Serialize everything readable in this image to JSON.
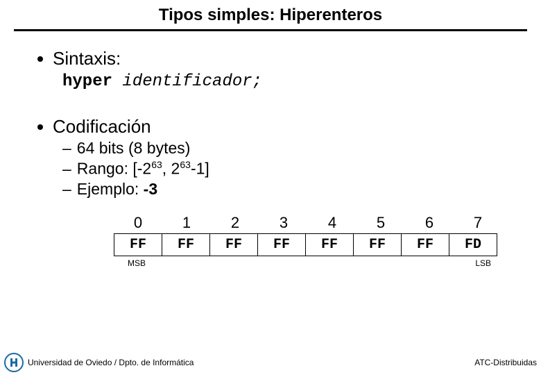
{
  "title": "Tipos simples: Hiperenteros",
  "bullets": {
    "syntax": {
      "label": "Sintaxis:",
      "keyword": "hyper",
      "identifier": "identificador;"
    },
    "coding": {
      "label": "Codificación",
      "subs": {
        "bits": "64 bits (8 bytes)",
        "range_prefix": "Rango: [-2",
        "range_mid": ", 2",
        "range_suffix": "-1]",
        "exp": "63",
        "example_label": "Ejemplo: ",
        "example_value": "-3"
      }
    }
  },
  "table": {
    "indices": [
      "0",
      "1",
      "2",
      "3",
      "4",
      "5",
      "6",
      "7"
    ],
    "values": [
      "FF",
      "FF",
      "FF",
      "FF",
      "FF",
      "FF",
      "FF",
      "FD"
    ],
    "msb": "MSB",
    "lsb": "LSB"
  },
  "footer": {
    "university": "Universidad de Oviedo / Dpto. de Informática",
    "course": "ATC-Distribuidas"
  }
}
